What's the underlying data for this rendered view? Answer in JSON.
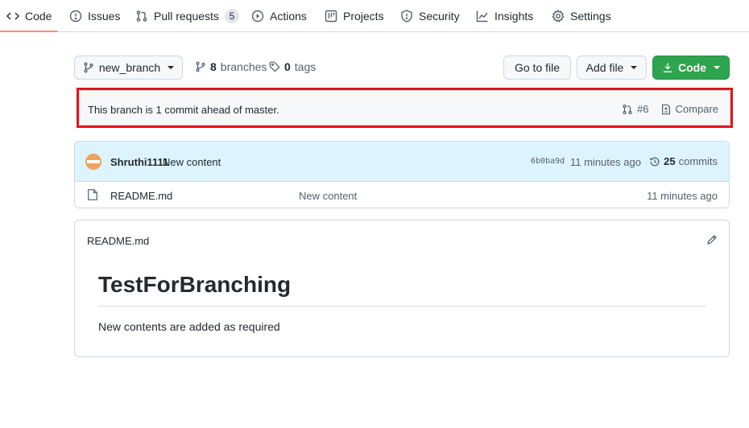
{
  "nav": {
    "tabs": [
      {
        "label": "Code",
        "icon": "code-icon",
        "active": true
      },
      {
        "label": "Issues",
        "icon": "issue-icon"
      },
      {
        "label": "Pull requests",
        "icon": "pull-request-icon",
        "count": "5"
      },
      {
        "label": "Actions",
        "icon": "play-icon"
      },
      {
        "label": "Projects",
        "icon": "project-board-icon"
      },
      {
        "label": "Security",
        "icon": "shield-icon"
      },
      {
        "label": "Insights",
        "icon": "graph-icon"
      },
      {
        "label": "Settings",
        "icon": "gear-icon"
      }
    ],
    "active_color": "#fd8c73"
  },
  "toolbar": {
    "branch_name": "new_branch",
    "branches_count": "8",
    "branches_label": "branches",
    "tags_count": "0",
    "tags_label": "tags",
    "go_to_file": "Go to file",
    "add_file": "Add file",
    "code": "Code",
    "code_button_color": "#2da44e"
  },
  "ahead": {
    "text": "This branch is 1 commit ahead of master.",
    "pr_number": "#6",
    "compare": "Compare",
    "highlight_color": "#e0161e"
  },
  "latest_commit": {
    "author": "Shruthi1111",
    "message": "New content",
    "sha": "6b0ba9d",
    "time": "11 minutes ago",
    "commits_count": "25",
    "commits_label": "commits"
  },
  "files": [
    {
      "name": "README.md",
      "message": "New content",
      "time": "11 minutes ago"
    }
  ],
  "readme": {
    "title": "README.md",
    "heading": "TestForBranching",
    "paragraph": "New contents are added as required"
  }
}
